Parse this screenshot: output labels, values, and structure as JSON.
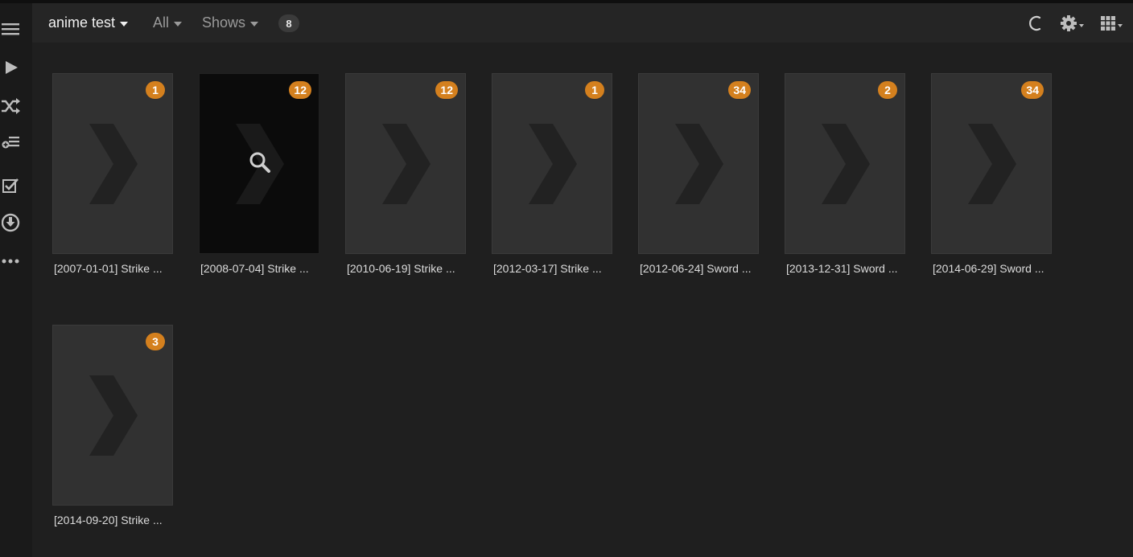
{
  "header": {
    "library_name": "anime test",
    "filter_label": "All",
    "type_label": "Shows",
    "item_count": "8"
  },
  "sidebar": {
    "icons": [
      "menu-icon",
      "play-icon",
      "shuffle-icon",
      "add-to-playlist-icon",
      "checklist-icon",
      "download-icon",
      "more-icon"
    ]
  },
  "colors": {
    "accent": "#d4801e",
    "background": "#1f1f1f",
    "header": "#252525",
    "poster": "#313131"
  },
  "items": [
    {
      "title": "[2007-01-01] Strike ...",
      "count": "1"
    },
    {
      "title": "[2008-07-04] Strike ...",
      "count": "12"
    },
    {
      "title": "[2010-06-19] Strike ...",
      "count": "12"
    },
    {
      "title": "[2012-03-17] Strike ...",
      "count": "1"
    },
    {
      "title": "[2012-06-24] Sword ...",
      "count": "34"
    },
    {
      "title": "[2013-12-31] Sword ...",
      "count": "2"
    },
    {
      "title": "[2014-06-29] Sword ...",
      "count": "34"
    },
    {
      "title": "[2014-09-20] Strike ...",
      "count": "3"
    }
  ]
}
